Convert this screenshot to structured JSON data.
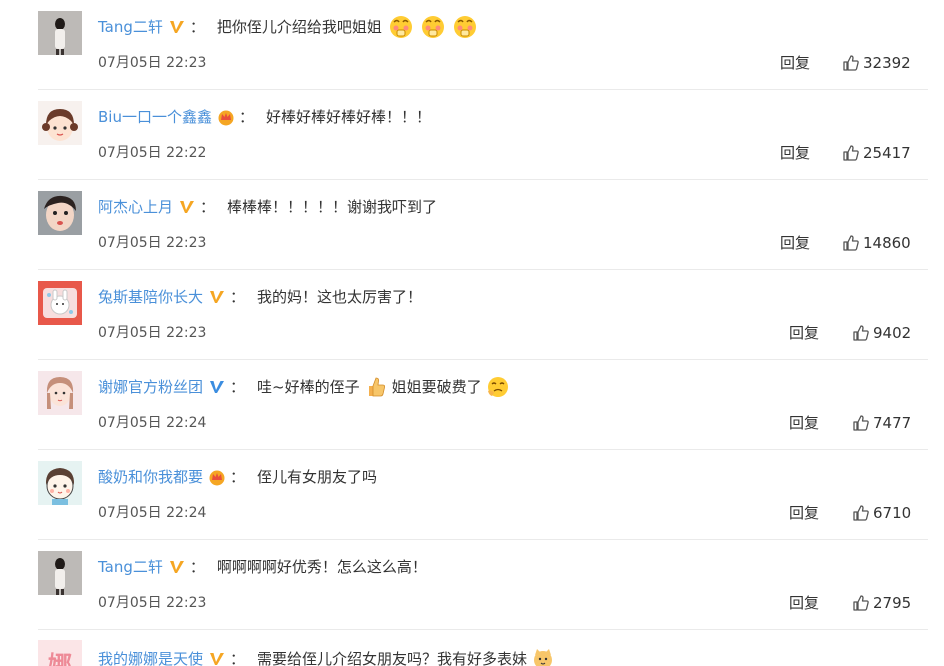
{
  "comments": [
    {
      "username": "Tang二轩",
      "badge": "verified-v",
      "colon": "：",
      "text": "把你侄儿介绍给我吧姐姐",
      "emojis": [
        "blush-emoji",
        "blush-emoji",
        "blush-emoji"
      ],
      "time": "07月05日 22:23",
      "reply_label": "回复",
      "likes": "32392"
    },
    {
      "username": "Biu一口一个鑫鑫",
      "badge": "crown",
      "colon": "：",
      "text": "好棒好棒好棒好棒！！！",
      "time": "07月05日 22:22",
      "reply_label": "回复",
      "likes": "25417"
    },
    {
      "username": "阿杰心上月",
      "badge": "verified-v",
      "colon": "：",
      "text": "棒棒棒！！！！！谢谢我吓到了",
      "time": "07月05日 22:23",
      "reply_label": "回复",
      "likes": "14860"
    },
    {
      "username": "兔斯基陪你长大",
      "badge": "verified-v",
      "colon": "：",
      "text": "我的妈！这也太厉害了！",
      "time": "07月05日 22:23",
      "reply_label": "回复",
      "likes": "9402"
    },
    {
      "username": "谢娜官方粉丝团",
      "badge": "verified-v-blue",
      "colon": "：",
      "text_a": "哇~好棒的侄子",
      "text_b": "姐姐要破费了",
      "time": "07月05日 22:24",
      "reply_label": "回复",
      "likes": "7477"
    },
    {
      "username": "酸奶和你我都要",
      "badge": "crown",
      "colon": "：",
      "text": "侄儿有女朋友了吗",
      "time": "07月05日 22:24",
      "reply_label": "回复",
      "likes": "6710"
    },
    {
      "username": "Tang二轩",
      "badge": "verified-v",
      "colon": "：",
      "text": "啊啊啊啊好优秀！怎么这么高！",
      "time": "07月05日 22:23",
      "reply_label": "回复",
      "likes": "2795"
    },
    {
      "username": "我的娜娜是天使",
      "badge": "verified-v",
      "colon": "：",
      "text": "需要给侄儿介绍女朋友吗？我有好多表妹",
      "avatar_text": "娜",
      "time": "",
      "reply_label": "",
      "likes": ""
    }
  ],
  "colors": {
    "username": "#4a90d9",
    "verify_gold": "#f5a623",
    "verify_blue": "#3b8de0",
    "crown_red": "#e94f3b",
    "divider": "#eaeaea"
  }
}
